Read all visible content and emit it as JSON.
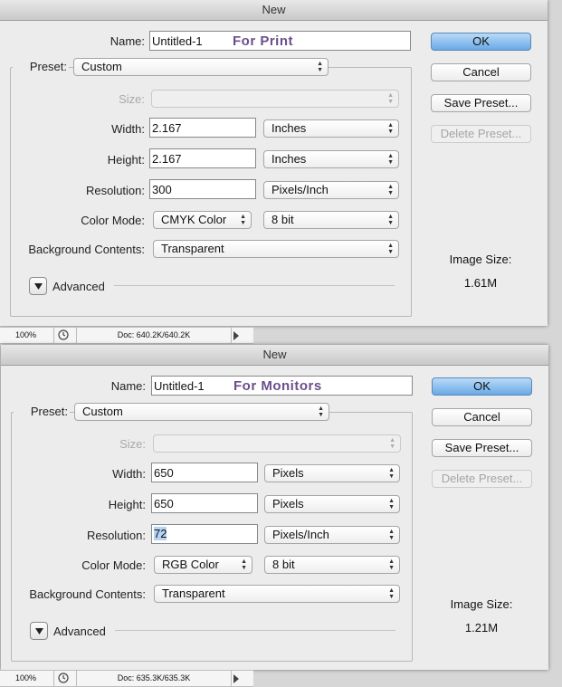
{
  "dialogs": [
    {
      "title": "New",
      "name_label": "Name:",
      "name_value": "Untitled-1",
      "name_annotation": "For Print",
      "preset_label": "Preset:",
      "preset_value": "Custom",
      "size_label": "Size:",
      "width_label": "Width:",
      "width_value": "2.167",
      "width_unit": "Inches",
      "height_label": "Height:",
      "height_value": "2.167",
      "height_unit": "Inches",
      "resolution_label": "Resolution:",
      "resolution_value": "300",
      "resolution_unit": "Pixels/Inch",
      "color_mode_label": "Color Mode:",
      "color_mode_value": "CMYK Color",
      "bit_depth_value": "8 bit",
      "background_label": "Background Contents:",
      "background_value": "Transparent",
      "advanced_label": "Advanced",
      "buttons": {
        "ok": "OK",
        "cancel": "Cancel",
        "save_preset": "Save Preset...",
        "delete_preset": "Delete Preset..."
      },
      "image_size_label": "Image Size:",
      "image_size_value": "1.61M",
      "status": {
        "zoom": "100%",
        "doc": "Doc: 640.2K/640.2K"
      }
    },
    {
      "title": "New",
      "name_label": "Name:",
      "name_value": "Untitled-1",
      "name_annotation": "For Monitors",
      "preset_label": "Preset:",
      "preset_value": "Custom",
      "size_label": "Size:",
      "width_label": "Width:",
      "width_value": "650",
      "width_unit": "Pixels",
      "height_label": "Height:",
      "height_value": "650",
      "height_unit": "Pixels",
      "resolution_label": "Resolution:",
      "resolution_value": "72",
      "resolution_unit": "Pixels/Inch",
      "color_mode_label": "Color Mode:",
      "color_mode_value": "RGB Color",
      "bit_depth_value": "8 bit",
      "background_label": "Background Contents:",
      "background_value": "Transparent",
      "advanced_label": "Advanced",
      "buttons": {
        "ok": "OK",
        "cancel": "Cancel",
        "save_preset": "Save Preset...",
        "delete_preset": "Delete Preset..."
      },
      "image_size_label": "Image Size:",
      "image_size_value": "1.21M",
      "status": {
        "zoom": "100%",
        "doc": "Doc: 635.3K/635.3K"
      }
    }
  ],
  "colors": {
    "annotation": "#6a4f8c",
    "ok_button": "#6aa9e6"
  },
  "icons": {
    "select": "up-down-arrows-icon",
    "advanced": "disclosure-triangle-icon",
    "status_menu": "play-arrow-icon",
    "status_timer": "clock-icon"
  }
}
